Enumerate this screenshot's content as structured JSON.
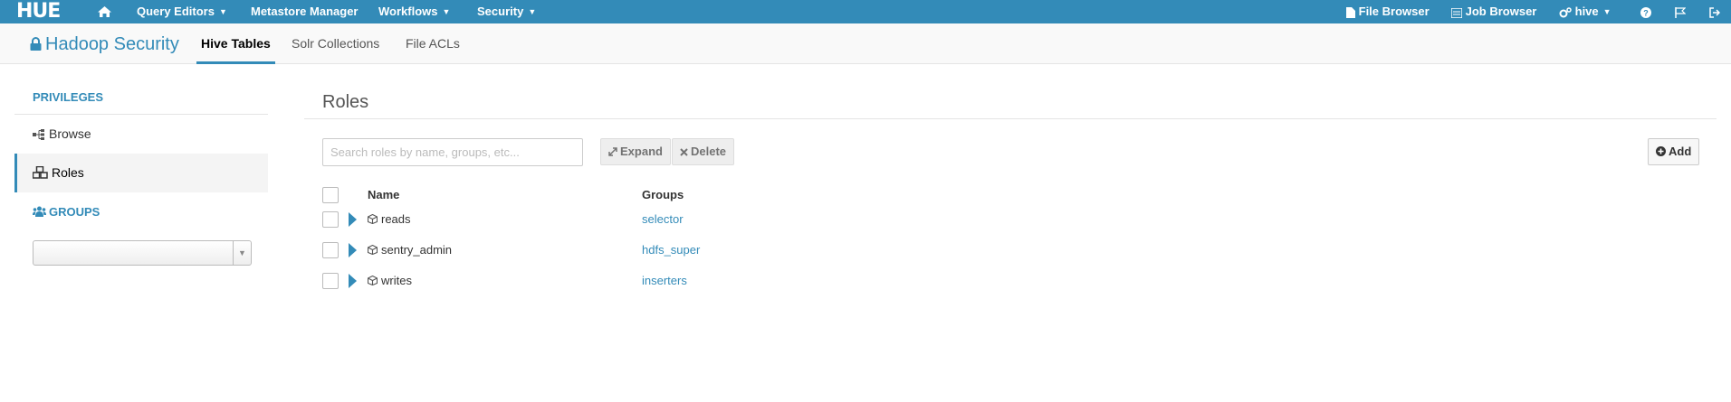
{
  "topnav": {
    "logo": "HUE",
    "items": [
      {
        "label": "Query Editors"
      },
      {
        "label": "Metastore Manager"
      },
      {
        "label": "Workflows"
      },
      {
        "label": "Security"
      }
    ],
    "right": {
      "file_browser": "File Browser",
      "job_browser": "Job Browser",
      "user": "hive"
    }
  },
  "subnav": {
    "brand": "Hadoop Security",
    "tabs": [
      {
        "label": "Hive Tables",
        "active": true
      },
      {
        "label": "Solr Collections",
        "active": false
      },
      {
        "label": "File ACLs",
        "active": false
      }
    ]
  },
  "sidebar": {
    "privileges_header": "PRIVILEGES",
    "items": [
      {
        "label": "Browse",
        "icon": "sitemap-icon"
      },
      {
        "label": "Roles",
        "icon": "cubes-icon"
      }
    ],
    "groups_header": "GROUPS",
    "group_select_value": ""
  },
  "main": {
    "title": "Roles",
    "search_placeholder": "Search roles by name, groups, etc...",
    "expand_label": "Expand",
    "delete_label": "Delete",
    "add_label": "Add",
    "columns": {
      "name": "Name",
      "groups": "Groups"
    },
    "rows": [
      {
        "name": "reads",
        "group": "selector"
      },
      {
        "name": "sentry_admin",
        "group": "hdfs_super"
      },
      {
        "name": "writes",
        "group": "inserters"
      }
    ]
  },
  "colors": {
    "accent": "#338bb8",
    "navbar": "#338bb8"
  }
}
